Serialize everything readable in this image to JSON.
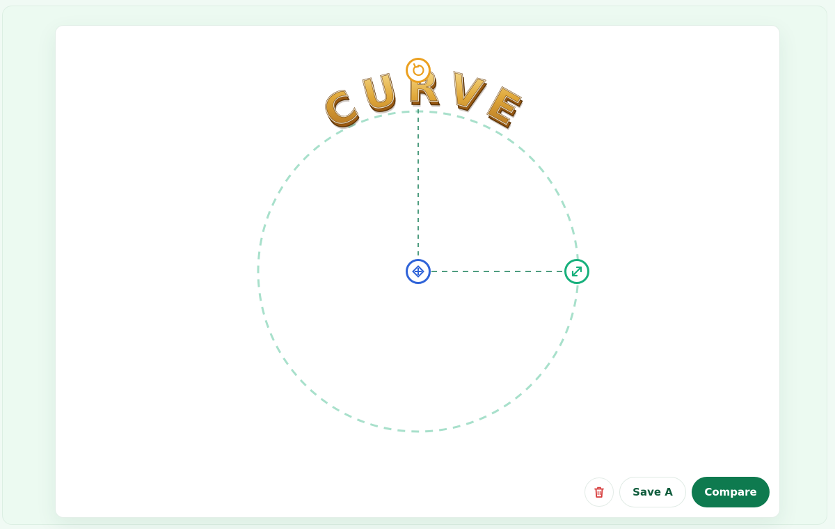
{
  "canvas": {
    "curved_text": "CURVE"
  },
  "handles": {
    "rotate_icon": "rotate-icon",
    "center_icon": "move-icon",
    "resize_icon": "resize-diagonal-icon"
  },
  "toolbar": {
    "delete_icon": "trash-icon",
    "save_label": "Save A",
    "compare_label": "Compare"
  },
  "colors": {
    "guide": "#a8e0cb",
    "guide_dark": "#4f9d80",
    "rotate": "#eba020",
    "center": "#2f63d8",
    "resize": "#17b07c",
    "primary": "#0e7a4f",
    "delete": "#d63b3b"
  }
}
